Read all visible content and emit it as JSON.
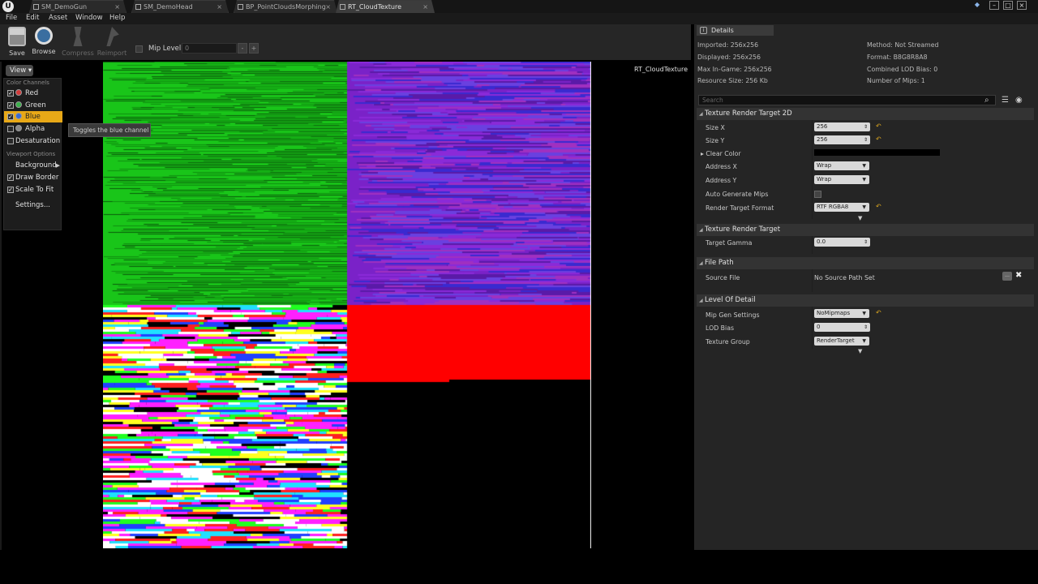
{
  "tabs": [
    {
      "label": "SM_DemoGun",
      "active": false
    },
    {
      "label": "SM_DemoHead",
      "active": false
    },
    {
      "label": "BP_PointCloudsMorphing",
      "active": false
    },
    {
      "label": "RT_CloudTexture",
      "active": true
    }
  ],
  "menu": [
    "File",
    "Edit",
    "Asset",
    "Window",
    "Help"
  ],
  "toolbar": {
    "buttons": [
      {
        "label": "Save",
        "icon": "save-icon",
        "enabled": true
      },
      {
        "label": "Browse",
        "icon": "browse-icon",
        "enabled": true
      },
      {
        "label": "Compress",
        "icon": "compress-icon",
        "enabled": false
      },
      {
        "label": "Reimport",
        "icon": "reimport-icon",
        "enabled": false
      }
    ],
    "mip_level_label": "Mip Level:",
    "mip_level_value": "0",
    "mip_minus": "-",
    "mip_plus": "+"
  },
  "viewport": {
    "texture_name": "RT_CloudTexture",
    "view_button": "View",
    "color_channels_heading": "Color Channels",
    "channels": [
      {
        "label": "Red",
        "checked": true,
        "color": "#d23a3a"
      },
      {
        "label": "Green",
        "checked": true,
        "color": "#3ab04a"
      },
      {
        "label": "Blue",
        "checked": true,
        "color": "#3a6ad2",
        "highlighted": true
      },
      {
        "label": "Alpha",
        "checked": false,
        "color": "#888888"
      }
    ],
    "desaturation": {
      "label": "Desaturation",
      "checked": false
    },
    "viewport_options_heading": "Viewport Options",
    "background_label": "Background",
    "draw_border": {
      "label": "Draw Border",
      "checked": true
    },
    "scale_to_fit": {
      "label": "Scale To Fit",
      "checked": true
    },
    "settings_label": "Settings...",
    "tooltip": "Toggles the blue channel"
  },
  "details": {
    "tab_label": "Details",
    "info": {
      "imported": "Imported: 256x256",
      "displayed": "Displayed: 256x256",
      "max_in_game": "Max In-Game: 256x256",
      "resource_size": "Resource Size: 256 Kb",
      "method": "Method: Not Streamed",
      "format": "Format: B8G8R8A8",
      "combined_lod": "Combined LOD Bias: 0",
      "num_mips": "Number of Mips: 1"
    },
    "search_placeholder": "Search",
    "sections": {
      "rt2d": {
        "title": "Texture Render Target 2D",
        "size_x_label": "Size X",
        "size_x": "256",
        "size_y_label": "Size Y",
        "size_y": "256",
        "clear_color_label": "Clear Color",
        "address_x_label": "Address X",
        "address_x": "Wrap",
        "address_y_label": "Address Y",
        "address_y": "Wrap",
        "auto_mips_label": "Auto Generate Mips",
        "rt_format_label": "Render Target Format",
        "rt_format": "RTF RGBA8"
      },
      "rt": {
        "title": "Texture Render Target",
        "gamma_label": "Target Gamma",
        "gamma": "0.0"
      },
      "file_path": {
        "title": "File Path",
        "source_label": "Source File",
        "source_value": "No Source Path Set"
      },
      "lod": {
        "title": "Level Of Detail",
        "mip_gen_label": "Mip Gen Settings",
        "mip_gen": "NoMipmaps",
        "lod_bias_label": "LOD Bias",
        "lod_bias": "0",
        "texture_group_label": "Texture Group",
        "texture_group": "RenderTarget"
      }
    }
  },
  "colors": {
    "accent": "#e8a817",
    "panel": "#252525",
    "green_quadrant": "#19c519",
    "purple_quadrant": "#7a22c8",
    "red_quadrant": "#ff0000"
  }
}
